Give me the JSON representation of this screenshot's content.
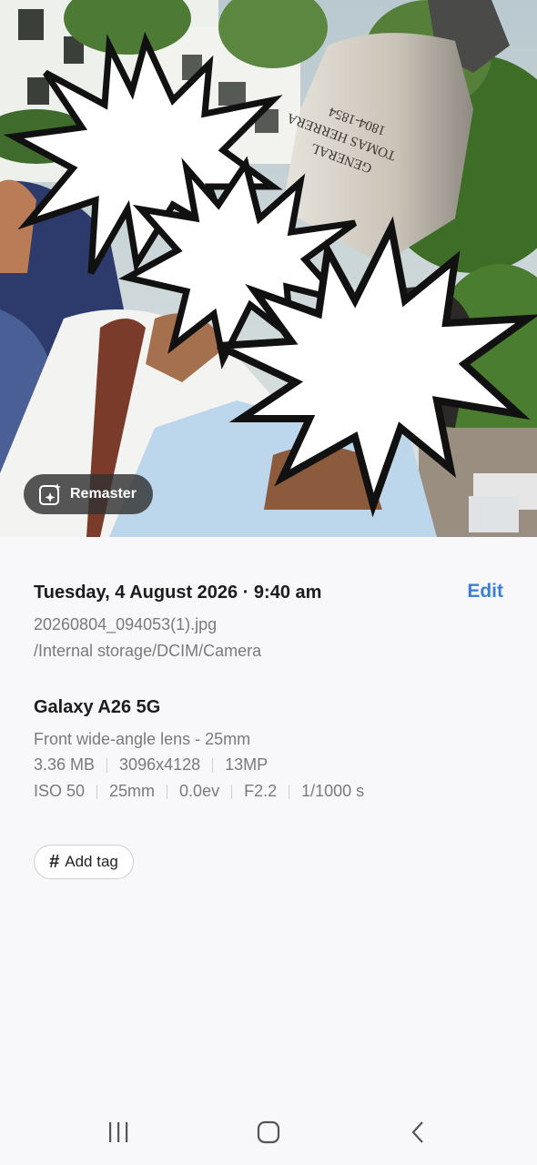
{
  "photo": {
    "remaster_label": "Remaster",
    "statue_inscription": [
      "GENERAL",
      "TOMAS HERRERA",
      "1804-1854"
    ]
  },
  "details": {
    "datetime": "Tuesday, 4 August 2026 · 9:40 am",
    "edit_label": "Edit",
    "filename": "20260804_094053(1).jpg",
    "path": "/Internal storage/DCIM/Camera",
    "device": "Galaxy A26 5G",
    "lens": "Front wide-angle lens - 25mm",
    "file_specs": [
      "3.36 MB",
      "3096x4128",
      "13MP"
    ],
    "exposure": [
      "ISO 50",
      "25mm",
      "0.0ev",
      "F2.2",
      "1/1000 s"
    ],
    "add_tag_label": "Add tag"
  },
  "navbar": {
    "items": [
      "recent-apps-icon",
      "home-icon",
      "back-icon"
    ]
  },
  "colors": {
    "accent": "#3d7fd1",
    "background": "#f8f8fa"
  }
}
